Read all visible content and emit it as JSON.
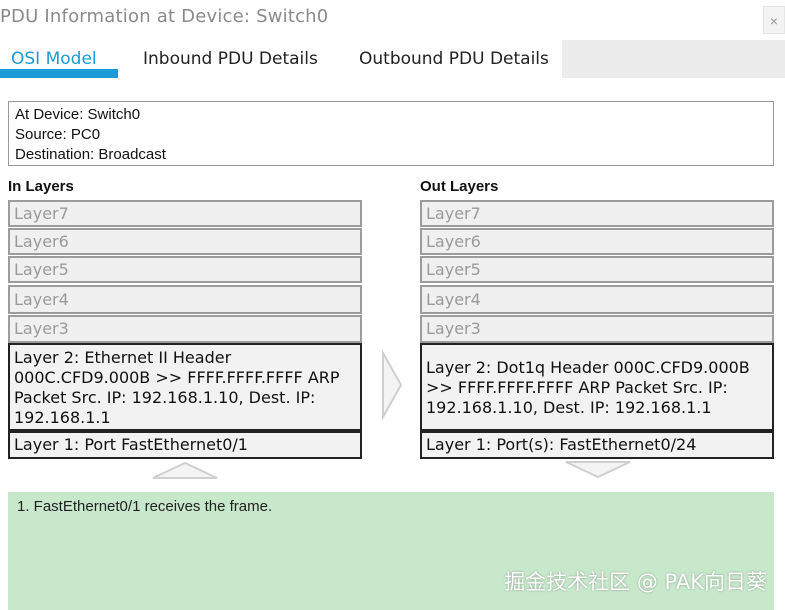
{
  "window": {
    "title": "PDU Information at Device: Switch0",
    "close_label": "×"
  },
  "tabs": [
    {
      "label": "OSI Model",
      "active": true
    },
    {
      "label": "Inbound PDU Details",
      "active": false
    },
    {
      "label": "Outbound PDU Details",
      "active": false
    }
  ],
  "info": {
    "device": "At Device: Switch0",
    "source": "Source: PC0",
    "destination": "Destination: Broadcast"
  },
  "in_layers": {
    "header": "In Layers",
    "layers": [
      "Layer7",
      "Layer6",
      "Layer5",
      "Layer4",
      "Layer3",
      "Layer 2: Ethernet II Header 000C.CFD9.000B >> FFFF.FFFF.FFFF ARP Packet Src. IP: 192.168.1.10, Dest. IP: 192.168.1.1",
      "Layer 1: Port FastEthernet0/1"
    ]
  },
  "out_layers": {
    "header": "Out Layers",
    "layers": [
      "Layer7",
      "Layer6",
      "Layer5",
      "Layer4",
      "Layer3",
      "Layer 2: Dot1q Header 000C.CFD9.000B >> FFFF.FFFF.FFFF ARP Packet Src. IP: 192.168.1.10, Dest. IP: 192.168.1.1",
      "Layer 1: Port(s): FastEthernet0/24"
    ]
  },
  "message": {
    "text": "1. FastEthernet0/1 receives the frame."
  },
  "watermark": {
    "text": "掘金技术社区 @ PAK向日葵"
  },
  "colors": {
    "accent": "#1a9ad6",
    "message_bg": "#c8e8cc"
  }
}
